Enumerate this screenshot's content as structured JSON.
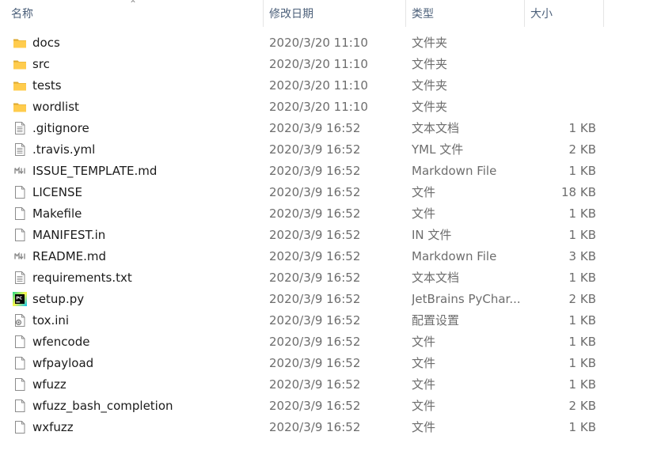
{
  "columns": {
    "name": "名称",
    "modified": "修改日期",
    "type": "类型",
    "size": "大小"
  },
  "files": [
    {
      "icon": "folder",
      "name": "docs",
      "modified": "2020/3/20 11:10",
      "type": "文件夹",
      "size": ""
    },
    {
      "icon": "folder",
      "name": "src",
      "modified": "2020/3/20 11:10",
      "type": "文件夹",
      "size": ""
    },
    {
      "icon": "folder",
      "name": "tests",
      "modified": "2020/3/20 11:10",
      "type": "文件夹",
      "size": ""
    },
    {
      "icon": "folder",
      "name": "wordlist",
      "modified": "2020/3/20 11:10",
      "type": "文件夹",
      "size": ""
    },
    {
      "icon": "text",
      "name": ".gitignore",
      "modified": "2020/3/9 16:52",
      "type": "文本文档",
      "size": "1 KB"
    },
    {
      "icon": "text",
      "name": ".travis.yml",
      "modified": "2020/3/9 16:52",
      "type": "YML 文件",
      "size": "2 KB"
    },
    {
      "icon": "markdown",
      "name": "ISSUE_TEMPLATE.md",
      "modified": "2020/3/9 16:52",
      "type": "Markdown File",
      "size": "1 KB"
    },
    {
      "icon": "file",
      "name": "LICENSE",
      "modified": "2020/3/9 16:52",
      "type": "文件",
      "size": "18 KB"
    },
    {
      "icon": "file",
      "name": "Makefile",
      "modified": "2020/3/9 16:52",
      "type": "文件",
      "size": "1 KB"
    },
    {
      "icon": "file",
      "name": "MANIFEST.in",
      "modified": "2020/3/9 16:52",
      "type": "IN 文件",
      "size": "1 KB"
    },
    {
      "icon": "markdown",
      "name": "README.md",
      "modified": "2020/3/9 16:52",
      "type": "Markdown File",
      "size": "3 KB"
    },
    {
      "icon": "text",
      "name": "requirements.txt",
      "modified": "2020/3/9 16:52",
      "type": "文本文档",
      "size": "1 KB"
    },
    {
      "icon": "pycharm",
      "name": "setup.py",
      "modified": "2020/3/9 16:52",
      "type": "JetBrains PyChar...",
      "size": "2 KB"
    },
    {
      "icon": "settings",
      "name": "tox.ini",
      "modified": "2020/3/9 16:52",
      "type": "配置设置",
      "size": "1 KB"
    },
    {
      "icon": "file",
      "name": "wfencode",
      "modified": "2020/3/9 16:52",
      "type": "文件",
      "size": "1 KB"
    },
    {
      "icon": "file",
      "name": "wfpayload",
      "modified": "2020/3/9 16:52",
      "type": "文件",
      "size": "1 KB"
    },
    {
      "icon": "file",
      "name": "wfuzz",
      "modified": "2020/3/9 16:52",
      "type": "文件",
      "size": "1 KB"
    },
    {
      "icon": "file",
      "name": "wfuzz_bash_completion",
      "modified": "2020/3/9 16:52",
      "type": "文件",
      "size": "2 KB"
    },
    {
      "icon": "file",
      "name": "wxfuzz",
      "modified": "2020/3/9 16:52",
      "type": "文件",
      "size": "1 KB"
    }
  ]
}
